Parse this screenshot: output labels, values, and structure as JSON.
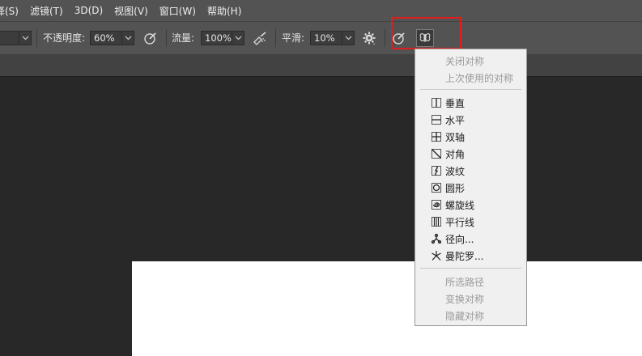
{
  "menubar": {
    "items": [
      {
        "label": "择(S)"
      },
      {
        "label": "滤镜(T)"
      },
      {
        "label": "3D(D)"
      },
      {
        "label": "视图(V)"
      },
      {
        "label": "窗口(W)"
      },
      {
        "label": "帮助(H)"
      }
    ]
  },
  "options": {
    "opacity_label": "不透明度:",
    "opacity_value": "60%",
    "flow_label": "流量:",
    "flow_value": "100%",
    "smooth_label": "平滑:",
    "smooth_value": "10%"
  },
  "symmetry_menu": {
    "items": [
      {
        "label": "关闭对称",
        "enabled": false,
        "icon": ""
      },
      {
        "label": "上次使用的对称",
        "enabled": false,
        "icon": ""
      },
      {
        "label": "垂直",
        "enabled": true,
        "icon": "vertical-icon"
      },
      {
        "label": "水平",
        "enabled": true,
        "icon": "horizontal-icon"
      },
      {
        "label": "双轴",
        "enabled": true,
        "icon": "dual-axis-icon"
      },
      {
        "label": "对角",
        "enabled": true,
        "icon": "diagonal-icon"
      },
      {
        "label": "波纹",
        "enabled": true,
        "icon": "wavy-icon"
      },
      {
        "label": "圆形",
        "enabled": true,
        "icon": "circle-icon"
      },
      {
        "label": "螺旋线",
        "enabled": true,
        "icon": "spiral-icon"
      },
      {
        "label": "平行线",
        "enabled": true,
        "icon": "parallel-lines-icon"
      },
      {
        "label": "径向...",
        "enabled": true,
        "icon": "radial-icon"
      },
      {
        "label": "曼陀罗...",
        "enabled": true,
        "icon": "mandala-icon"
      },
      {
        "label": "所选路径",
        "enabled": false,
        "icon": ""
      },
      {
        "label": "变换对称",
        "enabled": false,
        "icon": ""
      },
      {
        "label": "隐藏对称",
        "enabled": false,
        "icon": ""
      }
    ]
  },
  "colors": {
    "highlight_border": "#e01e1e"
  }
}
